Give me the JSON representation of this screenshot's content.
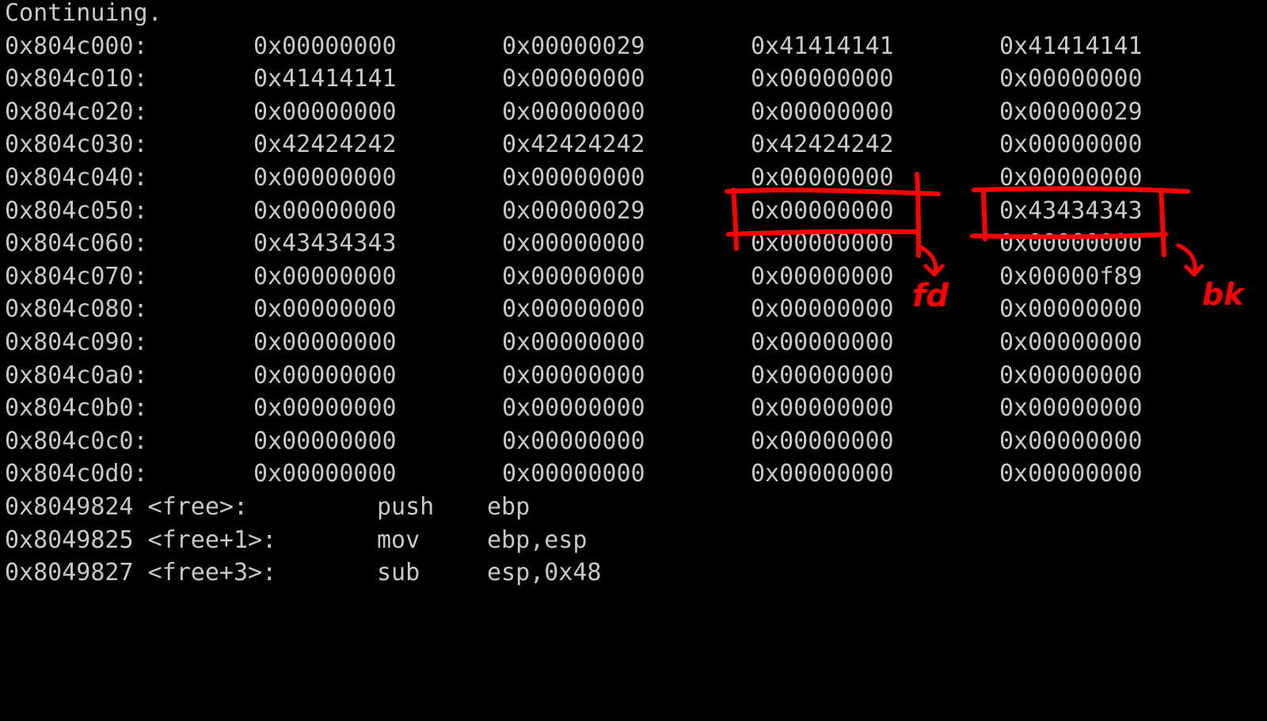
{
  "terminal": {
    "status_line": "Continuing.",
    "memory_rows": [
      {
        "address": "0x804c000:",
        "words": [
          "0x00000000",
          "0x00000029",
          "0x41414141",
          "0x41414141"
        ]
      },
      {
        "address": "0x804c010:",
        "words": [
          "0x41414141",
          "0x00000000",
          "0x00000000",
          "0x00000000"
        ]
      },
      {
        "address": "0x804c020:",
        "words": [
          "0x00000000",
          "0x00000000",
          "0x00000000",
          "0x00000029"
        ]
      },
      {
        "address": "0x804c030:",
        "words": [
          "0x42424242",
          "0x42424242",
          "0x42424242",
          "0x00000000"
        ]
      },
      {
        "address": "0x804c040:",
        "words": [
          "0x00000000",
          "0x00000000",
          "0x00000000",
          "0x00000000"
        ]
      },
      {
        "address": "0x804c050:",
        "words": [
          "0x00000000",
          "0x00000029",
          "0x00000000",
          "0x43434343"
        ]
      },
      {
        "address": "0x804c060:",
        "words": [
          "0x43434343",
          "0x00000000",
          "0x00000000",
          "0x00000000"
        ]
      },
      {
        "address": "0x804c070:",
        "words": [
          "0x00000000",
          "0x00000000",
          "0x00000000",
          "0x00000f89"
        ]
      },
      {
        "address": "0x804c080:",
        "words": [
          "0x00000000",
          "0x00000000",
          "0x00000000",
          "0x00000000"
        ]
      },
      {
        "address": "0x804c090:",
        "words": [
          "0x00000000",
          "0x00000000",
          "0x00000000",
          "0x00000000"
        ]
      },
      {
        "address": "0x804c0a0:",
        "words": [
          "0x00000000",
          "0x00000000",
          "0x00000000",
          "0x00000000"
        ]
      },
      {
        "address": "0x804c0b0:",
        "words": [
          "0x00000000",
          "0x00000000",
          "0x00000000",
          "0x00000000"
        ]
      },
      {
        "address": "0x804c0c0:",
        "words": [
          "0x00000000",
          "0x00000000",
          "0x00000000",
          "0x00000000"
        ]
      },
      {
        "address": "0x804c0d0:",
        "words": [
          "0x00000000",
          "0x00000000",
          "0x00000000",
          "0x00000000"
        ]
      }
    ],
    "disassembly": [
      {
        "location": "0x8049824 <free>:",
        "mnemonic": "push",
        "operands": "ebp"
      },
      {
        "location": "0x8049825 <free+1>:",
        "mnemonic": "mov",
        "operands": "ebp,esp"
      },
      {
        "location": "0x8049827 <free+3>:",
        "mnemonic": "sub",
        "operands": "esp,0x48"
      }
    ]
  },
  "annotations": {
    "fd_label": "fd",
    "bk_label": "bk",
    "ink_color": "#ff0000"
  },
  "colors": {
    "background": "#000000",
    "text": "#c8c8c8"
  }
}
